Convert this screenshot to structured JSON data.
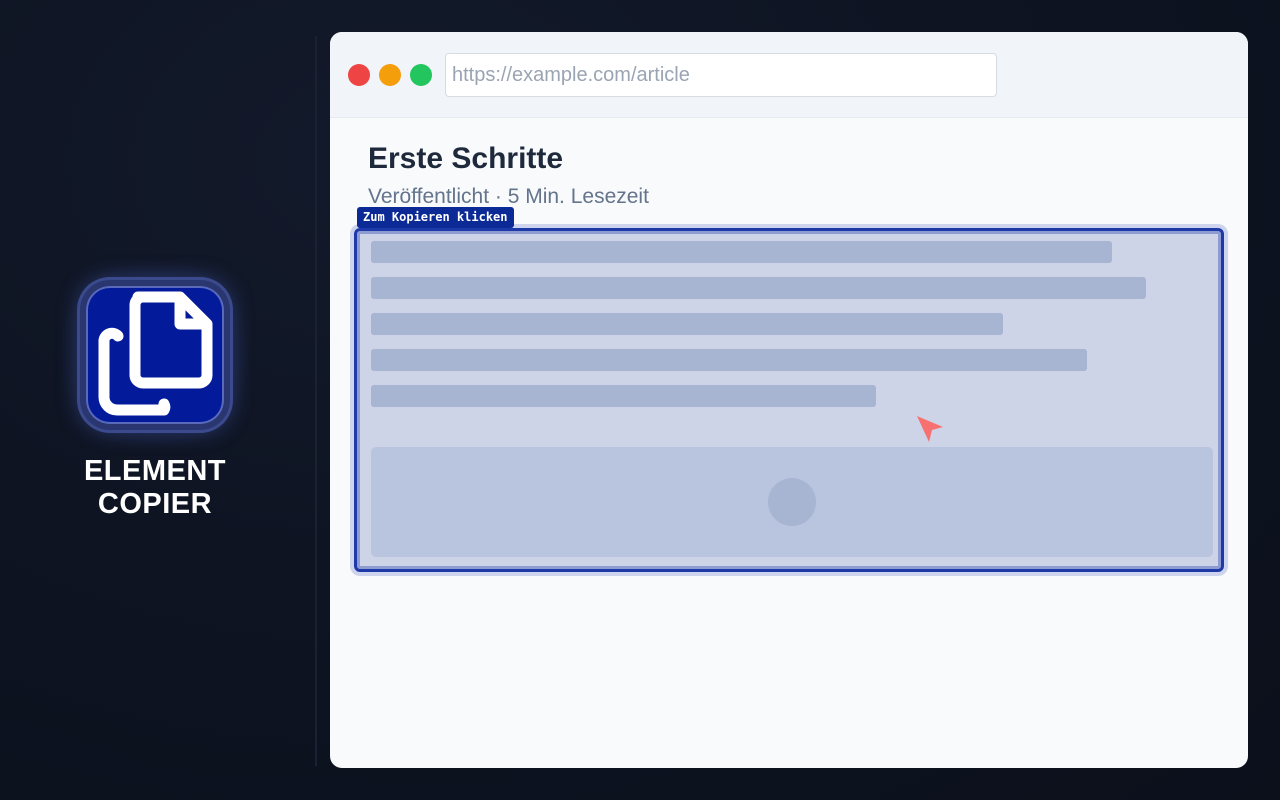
{
  "brand": {
    "line1": "ELEMENT",
    "line2": "COPIER",
    "icon": "copy-document-icon",
    "icon_bg_color": "#031b9a"
  },
  "browser": {
    "url": "https://example.com/article",
    "window_controls": [
      "close",
      "minimize",
      "maximize"
    ]
  },
  "page": {
    "title": "Erste Schritte",
    "meta": "Veröffentlicht · 5 Min. Lesezeit"
  },
  "selection": {
    "tooltip": "Zum Kopieren klicken",
    "highlight_color": "#1e3aa8"
  },
  "cursor": {
    "icon": "pointer-arrow-icon",
    "color": "#f87171"
  }
}
